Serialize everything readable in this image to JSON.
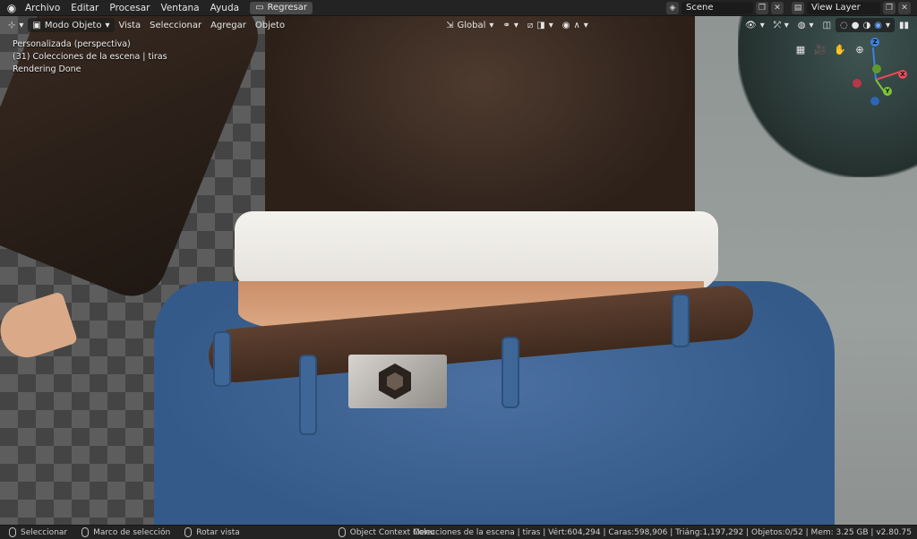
{
  "menubar": {
    "items": [
      "Archivo",
      "Editar",
      "Procesar",
      "Ventana",
      "Ayuda"
    ],
    "back_button": "Regresar",
    "scene_name": "Scene",
    "view_layer": "View Layer"
  },
  "viewport_header": {
    "mode": "Modo Objeto",
    "menus": [
      "Vista",
      "Seleccionar",
      "Agregar",
      "Objeto"
    ],
    "transform_orientation": "Global"
  },
  "overlay_info": {
    "view_name": "Personalizada (perspectiva)",
    "collection": "(31) Colecciones de la escena | tiras",
    "render_status": "Rendering Done"
  },
  "gizmo": {
    "axis_x": "X",
    "axis_y": "Y",
    "axis_z": "Z",
    "colors": {
      "x": "#e94a5a",
      "y": "#7cc33a",
      "z": "#3b82e6"
    }
  },
  "statusbar": {
    "select": "Seleccionar",
    "box_select": "Marco de selección",
    "rotate": "Rotar vista",
    "context_menu": "Object Context Menu",
    "stats": "Colecciones de la escena | tiras | Vért:604,294 | Caras:598,906 | Triáng:1,197,292 | Objetos:0/52 | Mem: 3.25 GB | v2.80.75"
  }
}
